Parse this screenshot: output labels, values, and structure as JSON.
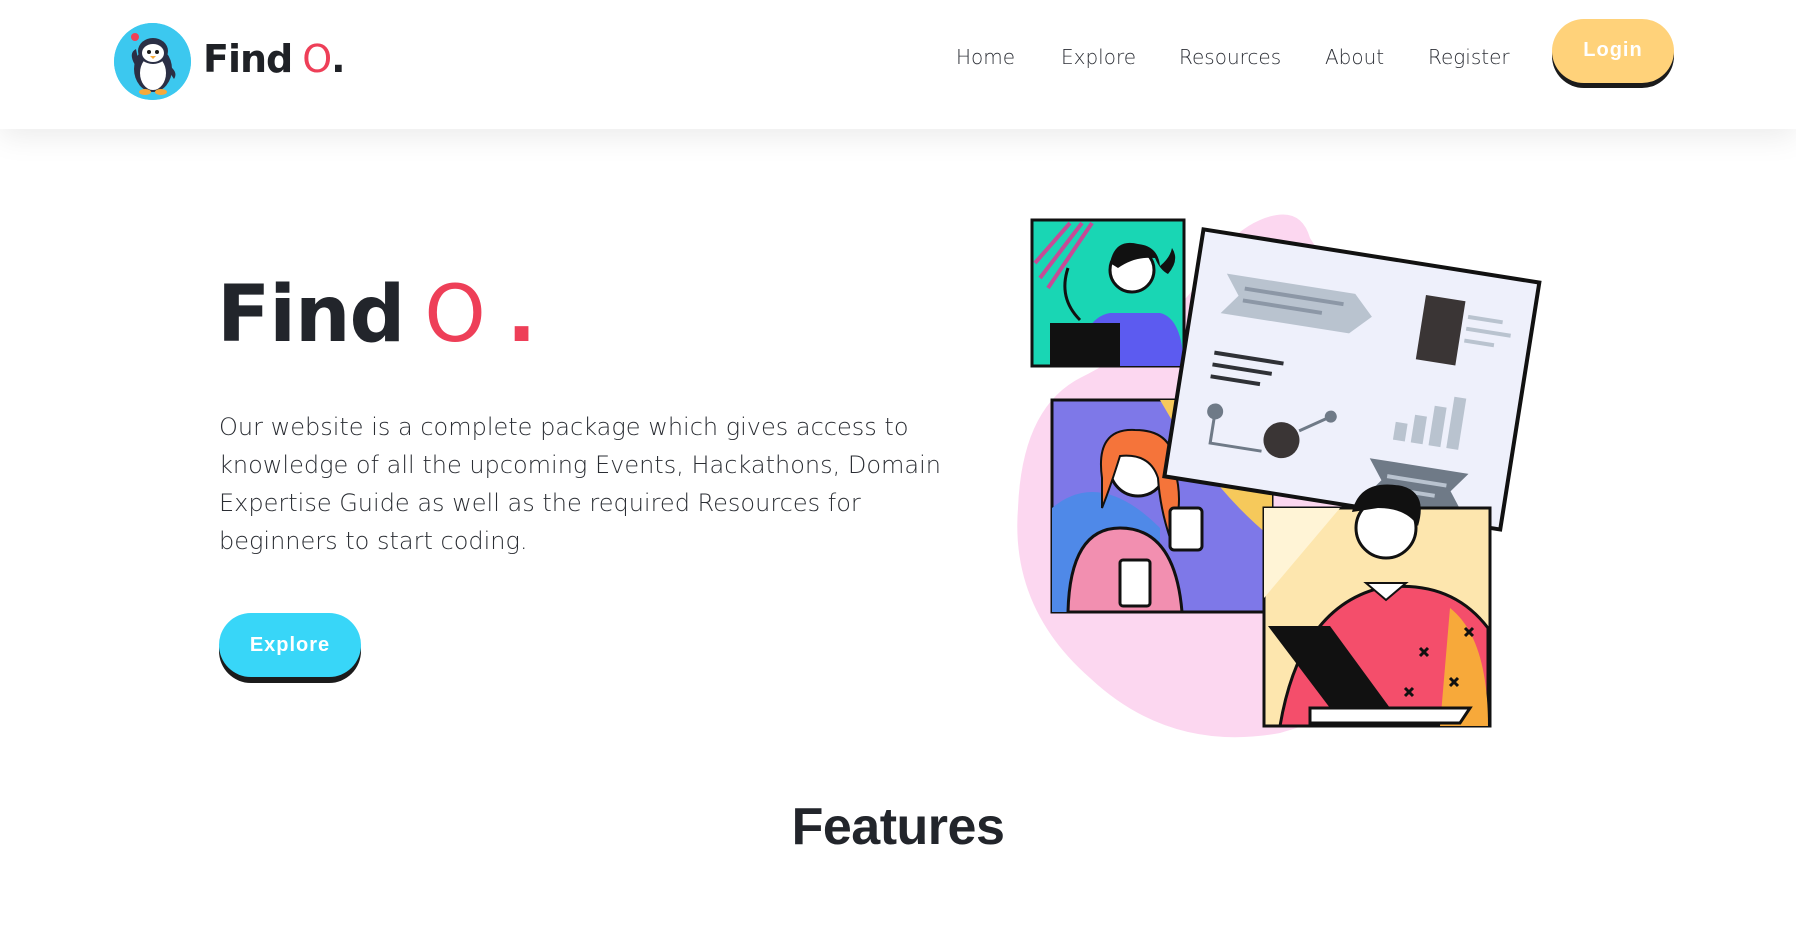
{
  "brand": {
    "name": "Find",
    "o": "O",
    "dot": "."
  },
  "nav": {
    "links": [
      {
        "label": "Home"
      },
      {
        "label": "Explore"
      },
      {
        "label": "Resources"
      },
      {
        "label": "About"
      },
      {
        "label": "Register"
      }
    ],
    "login_label": "Login"
  },
  "hero": {
    "title_word": "Find",
    "title_o": "O",
    "title_dot": ".",
    "description": "Our website is a complete package which gives access to knowledge of all the upcoming Events, Hackathons, Domain Expertise Guide as well as the required Resources for beginners to start coding.",
    "explore_label": "Explore"
  },
  "features": {
    "title": "Features"
  },
  "colors": {
    "accent_red": "#ee3f58",
    "login_yellow": "#ffd27a",
    "explore_cyan": "#38d6f8",
    "logo_cyan": "#3cc8ef"
  },
  "icons": {
    "logo": "penguin-icon",
    "illustration": "video-call-collaboration-illustration"
  }
}
